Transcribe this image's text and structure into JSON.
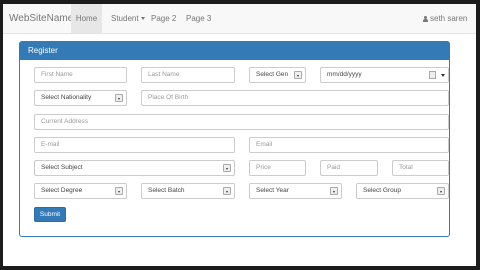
{
  "navbar": {
    "brand": "WebSiteName",
    "items": [
      {
        "label": "Home"
      },
      {
        "label": "Student"
      },
      {
        "label": "Page 2"
      },
      {
        "label": "Page 3"
      }
    ],
    "user": "seth saren"
  },
  "panel": {
    "title": "Register"
  },
  "form": {
    "first_name": "First Name",
    "last_name": "Last Name",
    "gender": "Select Gen",
    "dob": "mm/dd/yyyy",
    "nationality": "Select Nationality",
    "place_of_birth": "Place Of Birth",
    "current_address": "Current Address",
    "email1": "E-mail",
    "email2": "Email",
    "subject": "Select Subject",
    "price": "Price",
    "paid": "Paid",
    "total": "Total",
    "degree": "Select Degree",
    "batch": "Select Batch",
    "year": "Select Year",
    "group": "Select Group",
    "submit": "Submit"
  },
  "colors": {
    "primary": "#337ab7",
    "navbar_bg": "#f8f8f8",
    "active_tab": "#e7e7e7"
  }
}
